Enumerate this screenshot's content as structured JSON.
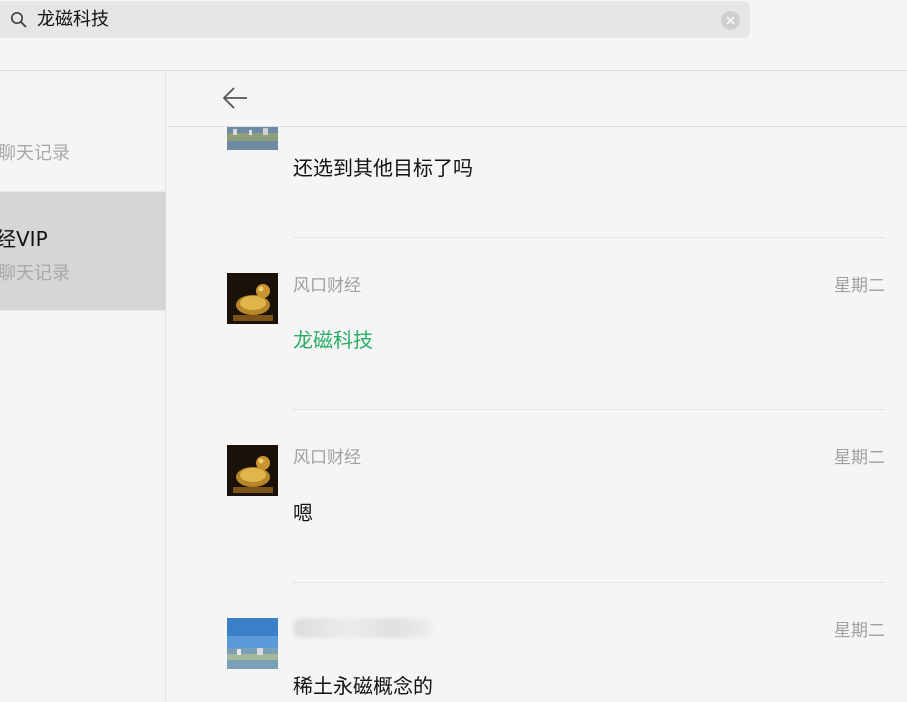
{
  "search": {
    "value": "龙磁科技"
  },
  "sidebar": {
    "items": [
      {
        "title": "",
        "subtitle": "聊天记录"
      },
      {
        "title": "经VIP",
        "subtitle": "聊天记录"
      }
    ]
  },
  "results": [
    {
      "sender": "",
      "time": "",
      "message": "还选到其他目标了吗"
    },
    {
      "sender": "风口财经",
      "time": "星期二",
      "message": "龙磁科技"
    },
    {
      "sender": "风口财经",
      "time": "星期二",
      "message": "嗯"
    },
    {
      "sender": "",
      "time": "星期二",
      "message": "稀土永磁概念的"
    }
  ],
  "colors": {
    "highlight": "#2aae67",
    "selected_bg": "#d6d6d6"
  }
}
